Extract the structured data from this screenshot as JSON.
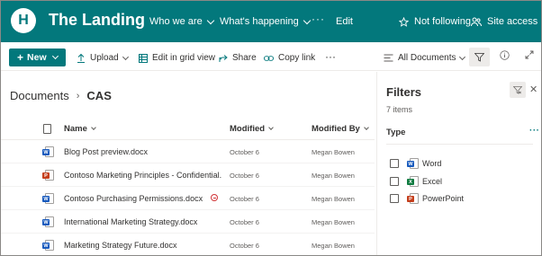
{
  "header": {
    "logo_letter": "H",
    "site_title": "The Landing",
    "nav": [
      "Who we are",
      "What's happening"
    ],
    "nav_more": "···",
    "edit": "Edit",
    "follow": "Not following",
    "site_access": "Site access",
    "brand_color": "#03787c"
  },
  "commands": {
    "new": "New",
    "upload": "Upload",
    "grid": "Edit in grid view",
    "share": "Share",
    "copy_link": "Copy link",
    "more": "···",
    "view": "All Documents"
  },
  "breadcrumb": {
    "root": "Documents",
    "separator": "›",
    "current": "CAS"
  },
  "columns": {
    "name": "Name",
    "modified": "Modified",
    "modified_by": "Modified By"
  },
  "files": [
    {
      "name": "Blog Post preview.docx",
      "type": "word",
      "modified": "October 6",
      "by": "Megan Bowen"
    },
    {
      "name": "Contoso Marketing Principles - Confidential...",
      "type": "ppt",
      "modified": "October 6",
      "by": "Megan Bowen"
    },
    {
      "name": "Contoso Purchasing Permissions.docx",
      "type": "word",
      "modified": "October 6",
      "by": "Megan Bowen"
    },
    {
      "name": "International Marketing Strategy.docx",
      "type": "word",
      "modified": "October 6",
      "by": "Megan Bowen"
    },
    {
      "name": "Marketing Strategy Future.docx",
      "type": "word",
      "modified": "October 6",
      "by": "Megan Bowen"
    }
  ],
  "filters": {
    "title": "Filters",
    "count": "7 items",
    "section": "Type",
    "more": "···",
    "options": [
      {
        "label": "Word",
        "type": "word"
      },
      {
        "label": "Excel",
        "type": "excel"
      },
      {
        "label": "PowerPoint",
        "type": "ppt"
      }
    ]
  },
  "icons": [
    "logo",
    "chevron-down-icon",
    "star-icon",
    "people-icon",
    "plus-icon",
    "upload-icon",
    "grid-icon",
    "share-icon",
    "link-icon",
    "view-list-icon",
    "filter-icon",
    "info-icon",
    "expand-icon",
    "document-icon",
    "sync-error-icon",
    "close-icon",
    "checkbox"
  ]
}
